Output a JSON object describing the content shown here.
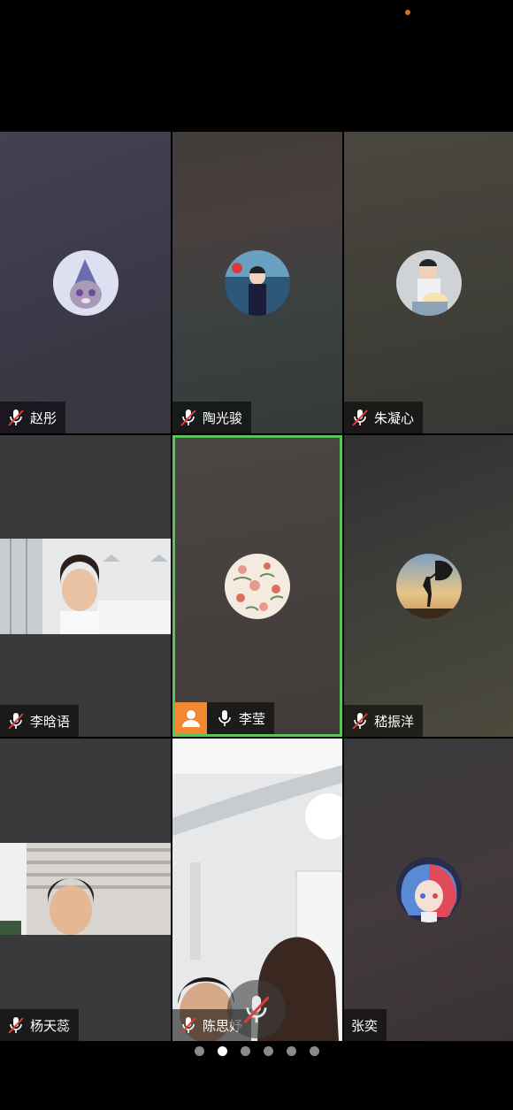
{
  "participants": [
    {
      "name": "赵彤",
      "muted": true,
      "avatar_icon": "cartoon-character-avatar"
    },
    {
      "name": "陶光骏",
      "muted": true,
      "avatar_icon": "child-photo-avatar"
    },
    {
      "name": "朱凝心",
      "muted": true,
      "avatar_icon": "child-with-cake-avatar"
    },
    {
      "name": "李晗语",
      "muted": true,
      "video": "camera-feed-girl"
    },
    {
      "name": "李莹",
      "muted": false,
      "host": true,
      "active_speaker": true,
      "avatar_icon": "floral-pattern-avatar"
    },
    {
      "name": "嵇振洋",
      "muted": true,
      "avatar_icon": "silhouette-sunset-avatar"
    },
    {
      "name": "杨天蕊",
      "muted": true,
      "video": "camera-feed-girl"
    },
    {
      "name": "陈思妤",
      "muted": true,
      "video": "camera-feed-room"
    },
    {
      "name": "张奕",
      "muted": false,
      "no_mic_icon": true,
      "avatar_icon": "anime-girl-avatar"
    }
  ],
  "pagination": {
    "total_pages": 6,
    "current_page": 2
  },
  "colors": {
    "active_border": "#5ac35a",
    "host_badge": "#f0892f",
    "status_dot": "#d2722e"
  }
}
